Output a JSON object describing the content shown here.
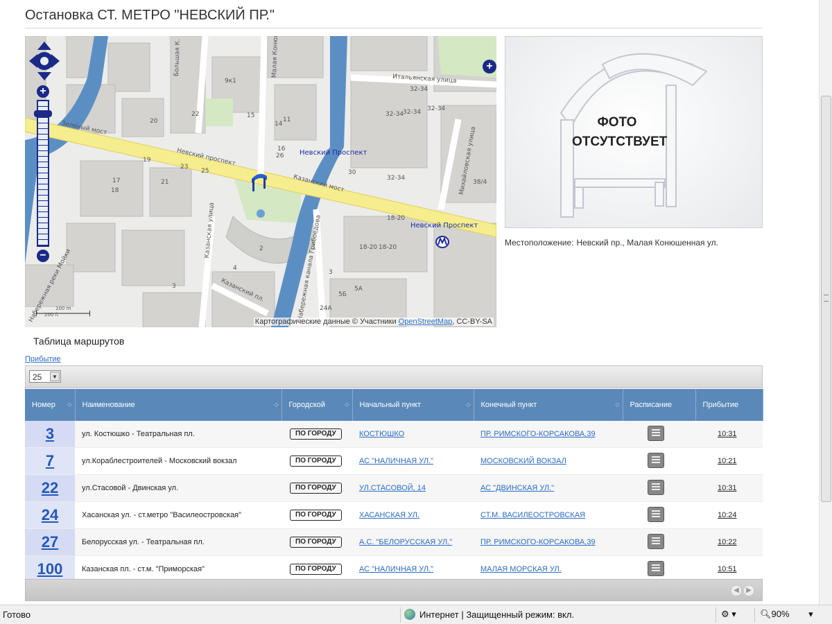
{
  "page": {
    "title": "Остановка СТ. МЕТРО \"НЕВСКИЙ ПР.\""
  },
  "map": {
    "labels": {
      "zeleny_most": "Зеленый мост",
      "nevsky_prospekt_street": "Невский проспект",
      "nevsky_prospekt_metro_1": "Невский Проспект",
      "nevsky_prospekt_metro_2": "Невский Проспект",
      "kazansky_most": "Казанский мост",
      "italyanskaya": "Итальянская улица",
      "bolshaya_konyushennaya": "Большая К.",
      "malaya_konyushennaya": "Малая Конюшенная улица",
      "kazanskaya_ulitsa": "Казанская улица",
      "kazansky_per": "Казанский пл.",
      "griboedova": "Набережная канала Грибоедова",
      "mikhailovskaya": "Михайловская улица",
      "moika": "Набережная реки Мойки"
    },
    "house_numbers": [
      "9к1",
      "32-34",
      "32-34",
      "32-34",
      "32-34",
      "32-34",
      "18-20",
      "18-20",
      "18-20",
      "3",
      "5Б",
      "5А",
      "24А",
      "38/4",
      "30",
      "19",
      "23",
      "25",
      "21",
      "17",
      "18",
      "15",
      "11",
      "14",
      "16",
      "22",
      "20",
      "26",
      "2",
      "3",
      "4"
    ],
    "scale_labels": [
      "100 m",
      "200 ft"
    ],
    "attribution_prefix": "Картографические данные © Участники ",
    "attribution_link": "OpenStreetMap",
    "attribution_suffix": ", CC-BY-SA",
    "zoom_level": 0.07,
    "colors": {
      "water": "#5b8fc4",
      "road_main": "#f5ed8e",
      "park": "#d4e8c4",
      "building": "#d4d3d0",
      "control": "#1b2a86"
    }
  },
  "photo": {
    "placeholder": "ФОТО\nОТСУТСТВУЕТ"
  },
  "location": {
    "label": "Местоположение:",
    "value": "Невский пр., Малая Конюшенная ул."
  },
  "routes": {
    "section_title": "Таблица маршрутов",
    "arrival_link": "Прибытие",
    "page_size": "25",
    "columns": [
      "Номер",
      "Наименование",
      "Городской",
      "Начальный пункт",
      "Конечный пункт",
      "Расписание",
      "Прибытие"
    ],
    "rows": [
      {
        "number": "3",
        "name": "ул. Костюшко - Театральная пл.",
        "type": "ПО ГОРОДУ",
        "start": "КОСТЮШКО",
        "end": "ПР. РИМСКОГО-КОРСАКОВА,39",
        "arrival": "10:31"
      },
      {
        "number": "7",
        "name": "ул.Кораблестроителей - Московский вокзал",
        "type": "ПО ГОРОДУ",
        "start": "АС \"НАЛИЧНАЯ УЛ.\"",
        "end": "МОСКОВСКИЙ ВОКЗАЛ",
        "arrival": "10:21"
      },
      {
        "number": "22",
        "name": "ул.Стасовой - Двинская ул.",
        "type": "ПО ГОРОДУ",
        "start": "УЛ.СТАСОВОЙ, 14",
        "end": "АС \"ДВИНСКАЯ УЛ.\"",
        "arrival": "10:31"
      },
      {
        "number": "24",
        "name": "Хасанская ул. - ст.метро \"Василеостровская\"",
        "type": "ПО ГОРОДУ",
        "start": "ХАСАНСКАЯ УЛ.",
        "end": "СТ.М. ВАСИЛЕОСТРОВСКАЯ",
        "arrival": "10:24"
      },
      {
        "number": "27",
        "name": "Белорусская ул. - Театральная пл.",
        "type": "ПО ГОРОДУ",
        "start": "А.С. \"БЕЛОРУССКАЯ УЛ.\"",
        "end": "ПР. РИМСКОГО-КОРСАКОВА,39",
        "arrival": "10:22"
      },
      {
        "number": "100",
        "name": "Казанская пл. - ст.м. \"Приморская\"",
        "type": "ПО ГОРОДУ",
        "start": "АС \"НАЛИЧНАЯ УЛ.\"",
        "end": "МАЛАЯ МОРСКАЯ УЛ.",
        "arrival": "10:51"
      }
    ]
  },
  "statusbar": {
    "ready": "Готово",
    "zone": "Интернет | Защищенный режим: вкл.",
    "zoom": "90%"
  }
}
